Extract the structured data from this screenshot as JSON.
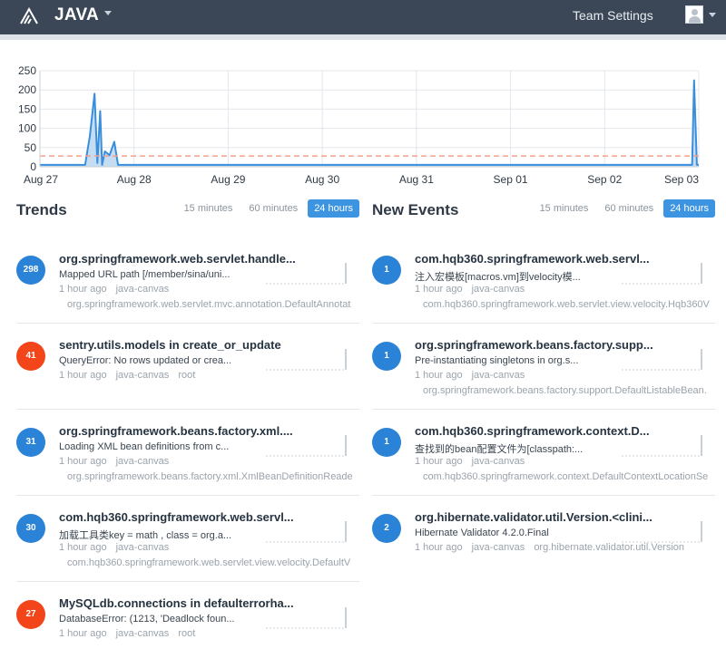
{
  "header": {
    "project": "JAVA",
    "team_settings": "Team Settings"
  },
  "chart_data": {
    "type": "area",
    "categories": [
      "Aug 27",
      "Aug 28",
      "Aug 29",
      "Aug 30",
      "Aug 31",
      "Sep 01",
      "Sep 02",
      "Sep 03"
    ],
    "yticks": [
      0,
      50,
      100,
      150,
      200,
      250
    ],
    "ylim": [
      0,
      250
    ],
    "xrange_days": [
      0,
      7
    ],
    "series": [
      {
        "x": [
          0,
          0.48,
          0.53,
          0.58,
          0.61,
          0.64,
          0.66,
          0.69,
          0.74,
          0.79,
          0.83,
          0.88,
          6.9,
          6.93,
          6.95,
          6.98,
          7
        ],
        "values": [
          5,
          5,
          80,
          190,
          10,
          145,
          5,
          40,
          30,
          65,
          5,
          5,
          5,
          5,
          225,
          5,
          5
        ]
      }
    ],
    "average_line": 28,
    "colors": {
      "line": "#3a8fdc",
      "fill": "#c5ddf3",
      "average": "#f2a08e",
      "grid": "#e3e7eb",
      "axis": "#2f3a46"
    },
    "grid": true
  },
  "trends": {
    "title": "Trends",
    "tabs": [
      "15 minutes",
      "60 minutes",
      "24 hours"
    ],
    "active_tab": "24 hours",
    "items": [
      {
        "count": "298",
        "color": "blue",
        "title": "org.springframework.web.servlet.handle...",
        "message": "Mapped URL path [/member/sina/uni...",
        "time": "1 hour ago",
        "project": "java-canvas",
        "extra": "",
        "culprit": "org.springframework.web.servlet.mvc.annotation.DefaultAnnotat"
      },
      {
        "count": "41",
        "color": "red",
        "title": "sentry.utils.models in create_or_update",
        "message": "QueryError: No rows updated or crea...",
        "time": "1 hour ago",
        "project": "java-canvas",
        "extra": "root",
        "culprit": ""
      },
      {
        "count": "31",
        "color": "blue",
        "title": "org.springframework.beans.factory.xml....",
        "message": "Loading XML bean definitions from c...",
        "time": "1 hour ago",
        "project": "java-canvas",
        "extra": "",
        "culprit": "org.springframework.beans.factory.xml.XmlBeanDefinitionReade"
      },
      {
        "count": "30",
        "color": "blue",
        "title": "com.hqb360.springframework.web.servl...",
        "message": "加载工具类key = math , class = org.a...",
        "time": "1 hour ago",
        "project": "java-canvas",
        "extra": "",
        "culprit": "com.hqb360.springframework.web.servlet.view.velocity.DefaultV"
      },
      {
        "count": "27",
        "color": "red",
        "title": "MySQLdb.connections in defaulterrorha...",
        "message": "DatabaseError: (1213, 'Deadlock foun...",
        "time": "1 hour ago",
        "project": "java-canvas",
        "extra": "root",
        "culprit": ""
      }
    ]
  },
  "new_events": {
    "title": "New Events",
    "tabs": [
      "15 minutes",
      "60 minutes",
      "24 hours"
    ],
    "active_tab": "24 hours",
    "items": [
      {
        "count": "1",
        "color": "blue",
        "title": "com.hqb360.springframework.web.servl...",
        "message": "注入宏模板[macros.vm]到velocity模...",
        "time": "1 hour ago",
        "project": "java-canvas",
        "extra": "",
        "culprit": "com.hqb360.springframework.web.servlet.view.velocity.Hqb360V"
      },
      {
        "count": "1",
        "color": "blue",
        "title": "org.springframework.beans.factory.supp...",
        "message": "Pre-instantiating singletons in org.s...",
        "time": "1 hour ago",
        "project": "java-canvas",
        "extra": "",
        "culprit": "org.springframework.beans.factory.support.DefaultListableBean."
      },
      {
        "count": "1",
        "color": "blue",
        "title": "com.hqb360.springframework.context.D...",
        "message": "查找到的bean配置文件为[classpath:...",
        "time": "1 hour ago",
        "project": "java-canvas",
        "extra": "",
        "culprit": "com.hqb360.springframework.context.DefaultContextLocationSe"
      },
      {
        "count": "2",
        "color": "blue",
        "title": "org.hibernate.validator.util.Version.<clini...",
        "message": "Hibernate Validator 4.2.0.Final",
        "time": "1 hour ago",
        "project": "java-canvas",
        "extra": "org.hibernate.validator.util.Version",
        "culprit": ""
      }
    ]
  }
}
